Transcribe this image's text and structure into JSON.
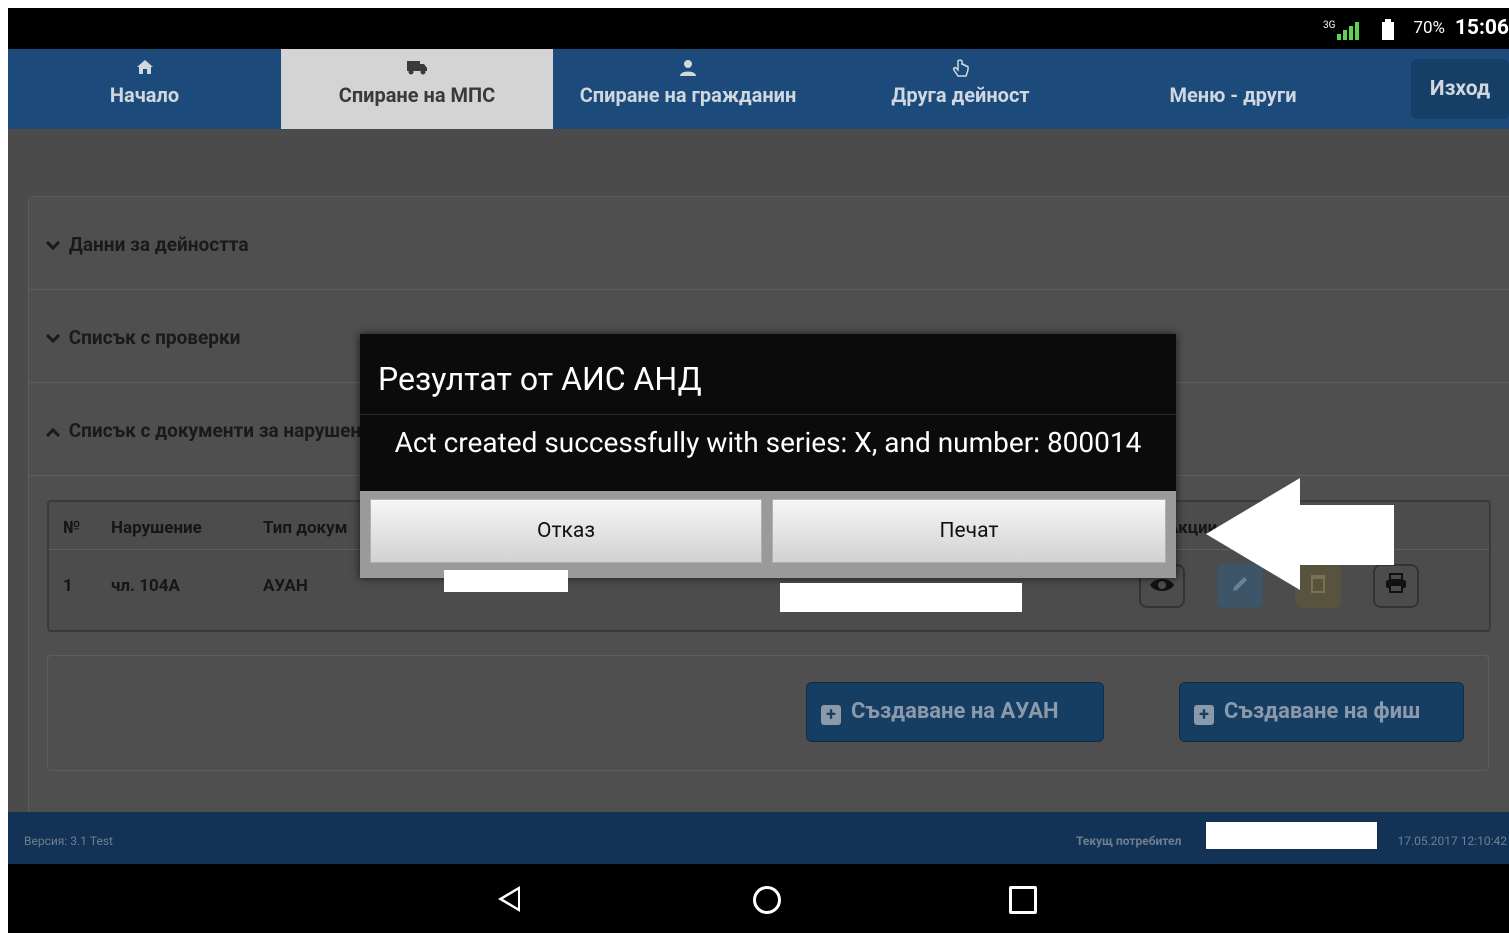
{
  "status_bar": {
    "network": "3G",
    "battery": "70%",
    "time": "15:06"
  },
  "nav": {
    "tabs": [
      {
        "label": "Начало",
        "icon": "home-icon"
      },
      {
        "label": "Спиране на МПС",
        "icon": "truck-icon",
        "active": true
      },
      {
        "label": "Спиране на гражданин",
        "icon": "user-icon"
      },
      {
        "label": "Друга дейност",
        "icon": "hand-pointer-icon"
      },
      {
        "label": "Меню - други"
      }
    ],
    "logout_label": "Изход"
  },
  "sections": {
    "activity": "Данни за дейността",
    "checks": "Списък с проверки",
    "documents": "Списък с документи за нарушения"
  },
  "table": {
    "headers": {
      "num": "№",
      "violation": "Нарушение",
      "doc_type": "Тип докум",
      "actions": "Акции"
    },
    "rows": [
      {
        "num": "1",
        "violation": "чл. 104А",
        "doc_type": "АУАН"
      }
    ]
  },
  "buttons": {
    "create_auan": "Създаване на АУАН",
    "create_fish": "Създаване на фиш"
  },
  "footer": {
    "version": "Версия: 3.1 Test",
    "current_user_label": "Текущ потребител",
    "timestamp": "17.05.2017 12:10:42"
  },
  "dialog": {
    "title": "Резултат от АИС АНД",
    "message": "Act created successfully with series: X, and number: 800014",
    "cancel_label": "Отказ",
    "print_label": "Печат"
  }
}
